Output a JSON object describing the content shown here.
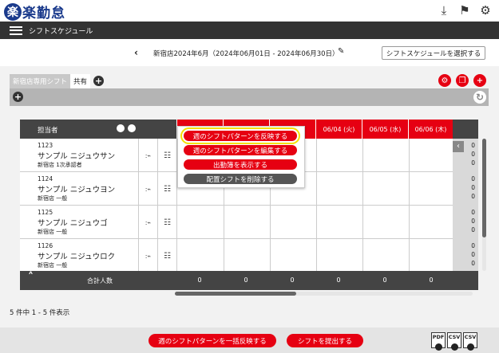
{
  "app": {
    "logo_mark": "楽",
    "logo_text": "楽勤怠"
  },
  "nav": {
    "title": "シフトスケジュール"
  },
  "schedule": {
    "title": "新宿店2024年6月（2024年06月01日 - 2024年06月30日）",
    "select_button": "シフトスケジュールを選択する"
  },
  "tabs": [
    {
      "label": "新宿店専用シフト",
      "active": true
    },
    {
      "label": "共有",
      "active": false
    }
  ],
  "table": {
    "name_header": "担当者",
    "dates": [
      "06/04 (火)",
      "06/05 (水)",
      "06/06 (木)"
    ],
    "rows": [
      {
        "code": "1123",
        "name": "サンプル ニジュウサン",
        "dept": "新宿店 1次承認者",
        "counts": [
          "0",
          "0",
          "0"
        ]
      },
      {
        "code": "1124",
        "name": "サンプル ニジュウヨン",
        "dept": "新宿店 一般",
        "counts": [
          "0",
          "0",
          "0"
        ]
      },
      {
        "code": "1125",
        "name": "サンプル ニジュウゴ",
        "dept": "新宿店 一般",
        "counts": [
          "0",
          "0",
          "0"
        ]
      },
      {
        "code": "1126",
        "name": "サンプル ニジュウロク",
        "dept": "新宿店 一般",
        "counts": [
          "0",
          "0",
          "0"
        ]
      }
    ],
    "total_label": "合計人数",
    "totals": [
      "0",
      "0",
      "0",
      "0",
      "0",
      "0"
    ]
  },
  "popup": {
    "items": [
      "週のシフトパターンを反映する",
      "週のシフトパターンを編集する",
      "出勤簿を表示する",
      "配置シフトを削除する"
    ]
  },
  "count_text": "5 件中 1 - 5 件表示",
  "bottom": {
    "apply_all": "週のシフトパターンを一括反映する",
    "submit": "シフトを提出する",
    "exports": [
      "PDF",
      "CSV",
      "CSV"
    ]
  },
  "colors": {
    "accent": "#e60012",
    "brand": "#1a3a8c",
    "highlight": "#f5e000"
  },
  "icons": [
    "inbox-icon",
    "flag-icon",
    "gear-icon",
    "pencil-icon",
    "refresh-icon",
    "copy-icon",
    "plus-icon"
  ]
}
